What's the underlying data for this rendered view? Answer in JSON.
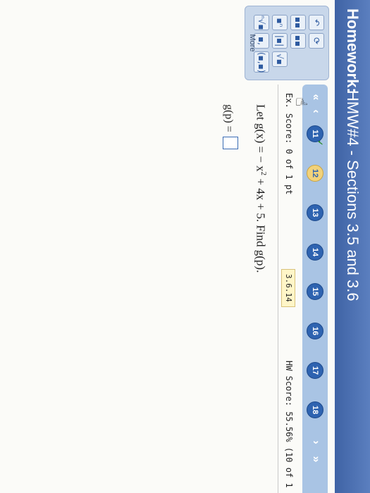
{
  "header": {
    "label": "Homework:",
    "title": "HMW#4 - Sections 3.5 and 3.6"
  },
  "toolbar": {
    "more_label": "More",
    "buttons": [
      "↶",
      "⟳",
      "▪▪",
      "▪▪",
      "▪ⁿ",
      "|▪|",
      "√▪",
      "ⁿ√▪",
      "▪,",
      "(▪,▪)"
    ]
  },
  "nav": {
    "questions": [
      "11",
      "12",
      "13",
      "14",
      "15",
      "16",
      "17",
      "18"
    ],
    "current": "12"
  },
  "score": {
    "ex_score": "Ex. Score: 0 of 1 pt",
    "code": "3.6.14",
    "hw_score": "HW Score: 55.56% (10 of 1"
  },
  "question": {
    "prompt_pre": "Let g(x) = − x",
    "prompt_exp": "2",
    "prompt_post": " + 4x + 5. Find g(p).",
    "answer_label": "g(p) ="
  }
}
